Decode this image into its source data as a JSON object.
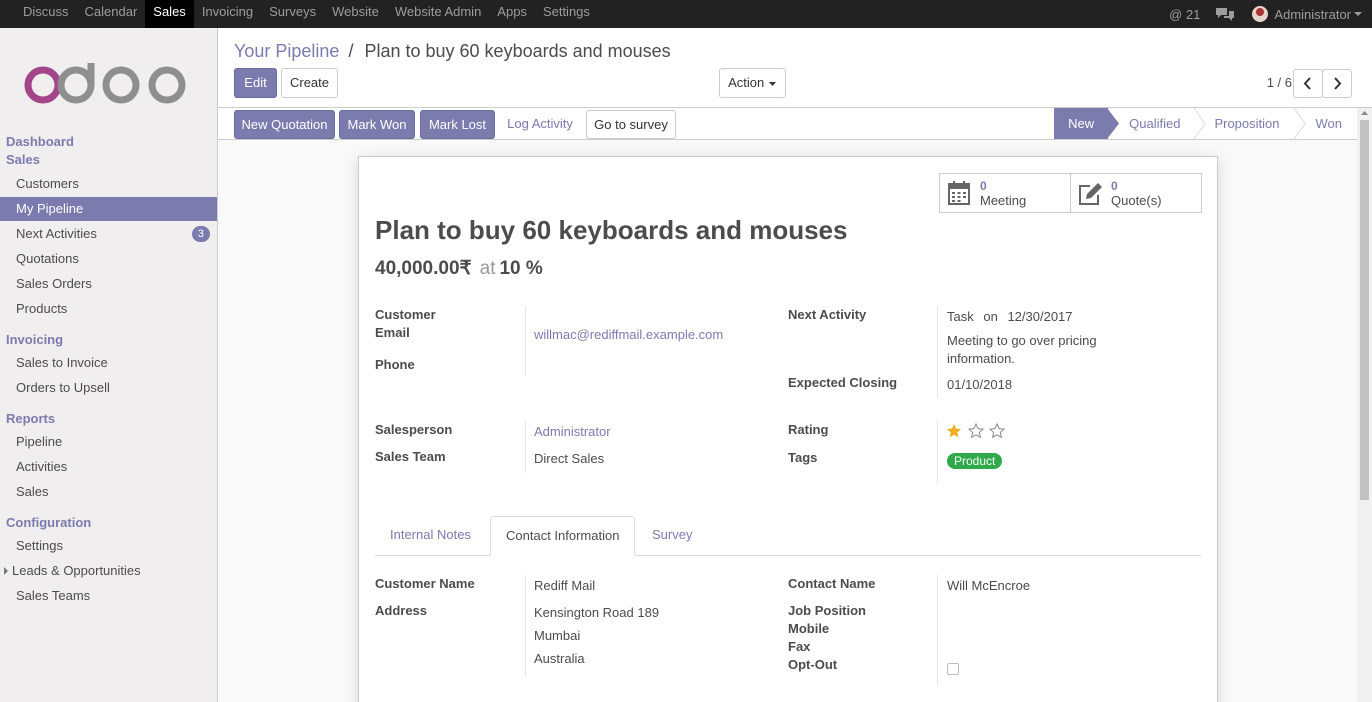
{
  "topbar": {
    "menus": [
      "Discuss",
      "Calendar",
      "Sales",
      "Invoicing",
      "Surveys",
      "Website",
      "Website Admin",
      "Apps",
      "Settings"
    ],
    "active_menu": "Sales",
    "mentions": "@ 21",
    "user": "Administrator"
  },
  "sidebar": {
    "sections": [
      {
        "title": "Dashboard"
      },
      {
        "title": "Sales",
        "items": [
          "Customers",
          "My Pipeline",
          "Next Activities",
          "Quotations",
          "Sales Orders",
          "Products"
        ]
      },
      {
        "title": "Invoicing",
        "items": [
          "Sales to Invoice",
          "Orders to Upsell"
        ]
      },
      {
        "title": "Reports",
        "items": [
          "Pipeline",
          "Activities",
          "Sales"
        ]
      },
      {
        "title": "Configuration",
        "items": [
          "Settings",
          "Leads & Opportunities",
          "Sales Teams"
        ]
      }
    ],
    "active_item": "My Pipeline",
    "next_activities_badge": "3"
  },
  "breadcrumb": {
    "parent": "Your Pipeline",
    "separator": "/",
    "current": "Plan to buy 60 keyboards and mouses"
  },
  "controls": {
    "edit": "Edit",
    "create": "Create",
    "action": "Action",
    "pager": "1 / 6"
  },
  "statusbar": {
    "buttons": {
      "new_quotation": "New Quotation",
      "mark_won": "Mark Won",
      "mark_lost": "Mark Lost",
      "log_activity": "Log Activity",
      "go_to_survey": "Go to survey"
    },
    "stages": [
      "New",
      "Qualified",
      "Proposition",
      "Won"
    ],
    "current_stage": "New"
  },
  "smart_buttons": {
    "meeting": {
      "count": "0",
      "label": "Meeting"
    },
    "quotes": {
      "count": "0",
      "label": "Quote(s)"
    }
  },
  "record": {
    "name": "Plan to buy 60 keyboards and mouses",
    "revenue": "40,000.00₹",
    "at": "at",
    "probability": "10 %",
    "labels": {
      "customer": "Customer",
      "email": "Email",
      "phone": "Phone",
      "next_activity": "Next Activity",
      "expected_closing": "Expected Closing",
      "salesperson": "Salesperson",
      "sales_team": "Sales Team",
      "rating": "Rating",
      "tags": "Tags"
    },
    "email": "willmac@rediffmail.example.com",
    "next_activity_type": "Task",
    "next_activity_on": "on",
    "next_activity_date": "12/30/2017",
    "next_activity_summary": "Meeting to go over pricing information.",
    "expected_closing": "01/10/2018",
    "salesperson": "Administrator",
    "sales_team": "Direct Sales",
    "rating": 1,
    "rating_max": 3,
    "tag": "Product"
  },
  "tabs": [
    "Internal Notes",
    "Contact Information",
    "Survey"
  ],
  "active_tab": "Contact Information",
  "contact": {
    "labels": {
      "customer_name": "Customer Name",
      "address": "Address",
      "contact_name": "Contact Name",
      "job_position": "Job Position",
      "mobile": "Mobile",
      "fax": "Fax",
      "opt_out": "Opt-Out"
    },
    "customer_name": "Rediff Mail",
    "street": "Kensington Road 189",
    "city": "Mumbai",
    "country": "Australia",
    "contact_name": "Will McEncroe",
    "opt_out": false
  },
  "colors": {
    "brand": "#7c7bad",
    "topbar": "#222222",
    "tag_green": "#30a84c",
    "star": "#f0ad1e"
  }
}
